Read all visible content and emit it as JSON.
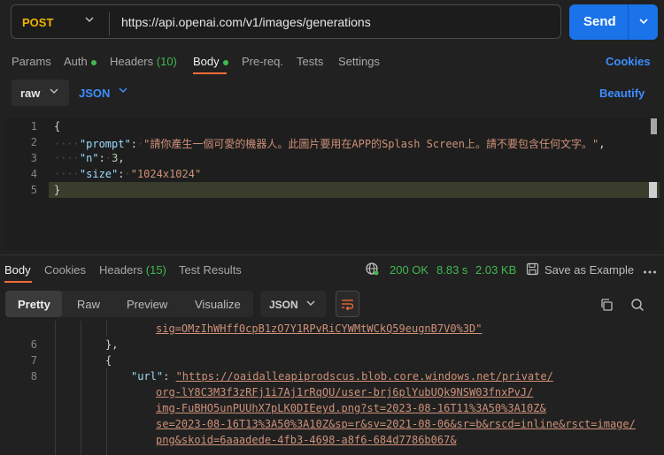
{
  "request": {
    "method": "POST",
    "url": "https://api.openai.com/v1/images/generations",
    "send_label": "Send"
  },
  "request_tabs": {
    "params": "Params",
    "auth": "Auth",
    "headers": "Headers",
    "headers_count": "(10)",
    "body": "Body",
    "prereq": "Pre-req.",
    "tests": "Tests",
    "settings": "Settings",
    "cookies": "Cookies"
  },
  "body_mode": {
    "type": "raw",
    "language": "JSON",
    "beautify": "Beautify"
  },
  "editor": {
    "line_numbers": [
      "1",
      "2",
      "3",
      "4",
      "5"
    ],
    "open_brace": "{",
    "close_brace": "}",
    "prompt_key": "\"prompt\"",
    "prompt_value": "\"請你產生一個可愛的機器人。此圖片要用在APP的Splash Screen上。請不要包含任何文字。\"",
    "n_key": "\"n\"",
    "n_value": "3",
    "size_key": "\"size\"",
    "size_value": "\"1024x1024\""
  },
  "response_tabs": {
    "body": "Body",
    "cookies": "Cookies",
    "headers": "Headers",
    "headers_count": "(15)",
    "test_results": "Test Results"
  },
  "response_meta": {
    "status": "200 OK",
    "time": "8.83 s",
    "size": "2.03 KB",
    "save_example": "Save as Example"
  },
  "response_view": {
    "pretty": "Pretty",
    "raw": "Raw",
    "preview": "Preview",
    "visualize": "Visualize",
    "format": "JSON"
  },
  "response_code": {
    "line_5_tail": "sig=OMzIhWHff0cpB1zO7Y1RPvRiCYWMtWCkQ59eugnB7V0%3D\"",
    "line_6": "},",
    "line_7": "{",
    "line_8_key": "\"url\"",
    "url_lines": [
      "\"https://oaidalleapiprodscus.blob.core.windows.net/private/",
      "org-lY8C3M3f3zRFj1i7Aj1rRqQU/user-brj6plYubUQk9NSW03fnxPvJ/",
      "img-FuBHO5unPUUhX7pLK0DIEeyd.png?st=2023-08-16T11%3A50%3A10Z&",
      "se=2023-08-16T13%3A50%3A10Z&sp=r&sv=2021-08-06&sr=b&rscd=inline&rsct=image/",
      "png&skoid=6aaadede-4fb3-4698-a8f6-684d7786b067&"
    ],
    "line_numbers": [
      "6",
      "7",
      "8"
    ]
  }
}
